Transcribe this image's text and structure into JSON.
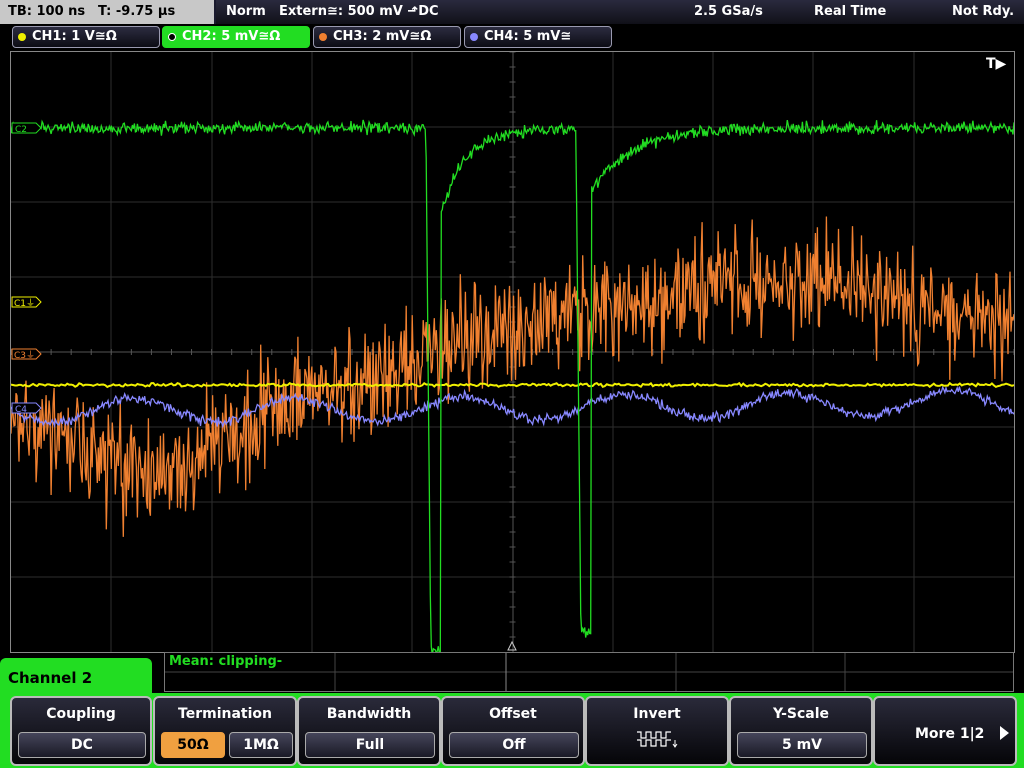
{
  "status": {
    "timebase": "TB: 100 ns",
    "trigger_time": "T: -9.75 µs",
    "mode": "Norm",
    "trigger_source": "Extern≅: 500 mV ⬏DC",
    "sample_rate": "2.5 GSa/s",
    "acq_mode": "Real Time",
    "ready": "Not Rdy."
  },
  "channels": [
    {
      "label": "CH1: 1 V≅Ω",
      "color": "#f0f000"
    },
    {
      "label": "CH2: 5 mV≅Ω",
      "color": "#22dd22"
    },
    {
      "label": "CH3: 2 mV≅Ω",
      "color": "#f08030"
    },
    {
      "label": "CH4: 5 mV≅",
      "color": "#8888ff"
    }
  ],
  "markers": {
    "trigger": "T▶",
    "c1": "C1⏚",
    "c2": "C2",
    "c3": "C3⏚",
    "c4": "C4"
  },
  "measurement": "Mean: clipping-",
  "panel_title": "Channel 2",
  "softkeys": {
    "coupling": {
      "title": "Coupling",
      "value": "DC"
    },
    "termination": {
      "title": "Termination",
      "opt1": "50Ω",
      "opt2": "1MΩ"
    },
    "bandwidth": {
      "title": "Bandwidth",
      "value": "Full"
    },
    "offset": {
      "title": "Offset",
      "value": "Off"
    },
    "invert": {
      "title": "Invert"
    },
    "yscale": {
      "title": "Y-Scale",
      "value": "5 mV"
    },
    "more": {
      "label": "More 1|2"
    }
  }
}
